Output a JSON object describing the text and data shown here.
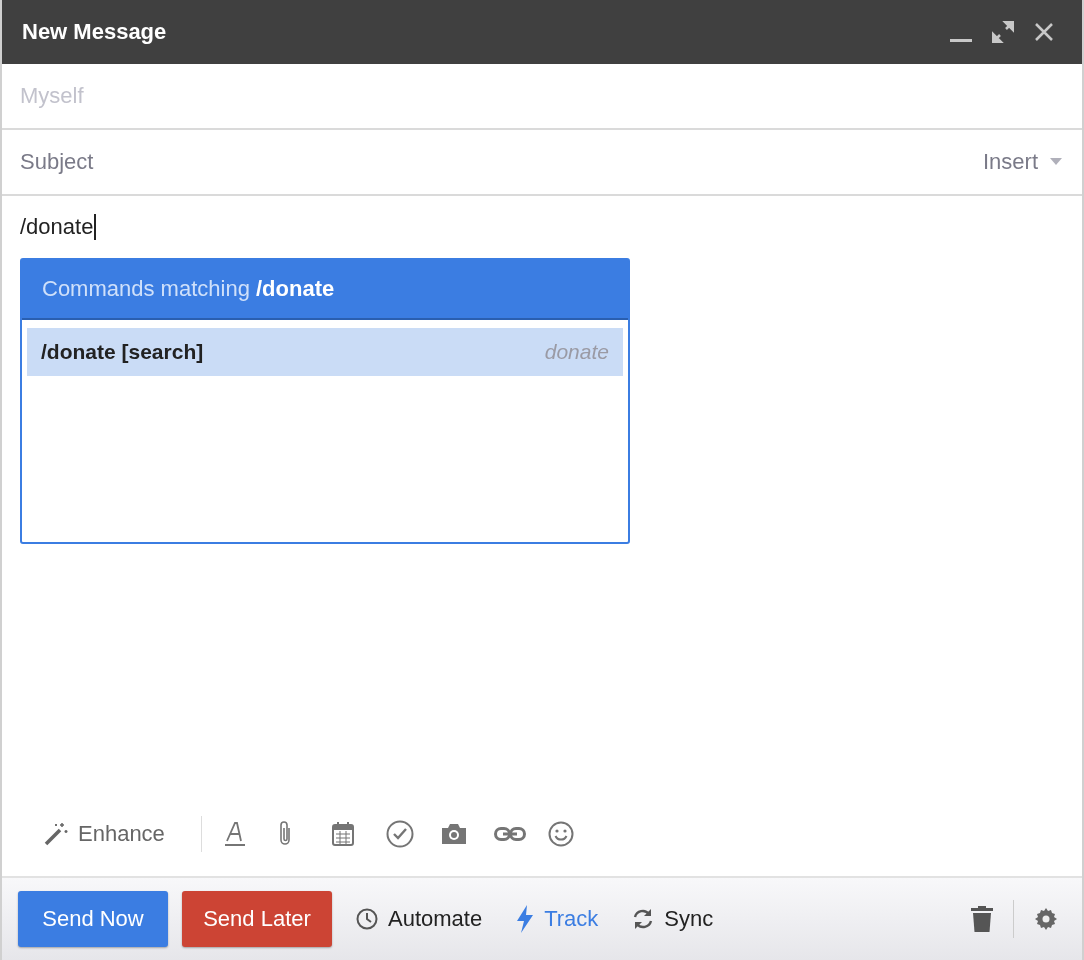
{
  "window": {
    "title": "New Message"
  },
  "to": {
    "placeholder": "Myself"
  },
  "subject": {
    "placeholder": "Subject",
    "insert_label": "Insert"
  },
  "body": {
    "value": "/donate"
  },
  "command_popup": {
    "heading": "Commands matching **/donate**",
    "items": [
      {
        "command": "/donate [search]",
        "keyword": "donate",
        "selected": true
      }
    ]
  },
  "toolbar": {
    "enhance_label": "Enhance",
    "icons": [
      {
        "kind": "format"
      },
      {
        "kind": "attach"
      },
      {
        "kind": "calendar"
      },
      {
        "kind": "check"
      },
      {
        "kind": "camera"
      },
      {
        "kind": "link"
      },
      {
        "kind": "emoji"
      }
    ]
  },
  "footer": {
    "send_now": "Send Now",
    "send_later": "Send Later",
    "actions": [
      {
        "kind": "clock",
        "label": "Automate",
        "active": false
      },
      {
        "kind": "bolt",
        "label": "Track",
        "active": true
      },
      {
        "kind": "sync",
        "label": "Sync",
        "active": false
      }
    ]
  }
}
